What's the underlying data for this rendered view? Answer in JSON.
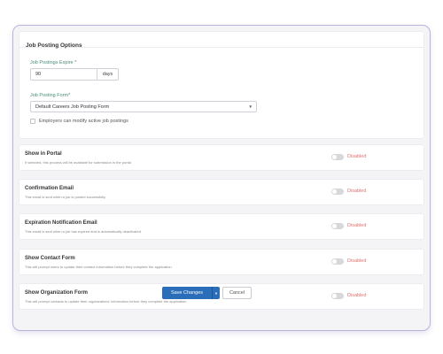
{
  "options": {
    "title": "Job Posting Options",
    "expire_label": "Job Postings Expire *",
    "expire_value": "90",
    "expire_unit": "days",
    "form_label": "Job Posting Form*",
    "form_selected": "Default Careers Job Posting Form",
    "modify_label": "Employers can modify active job postings",
    "modify_checked": false
  },
  "toggles": [
    {
      "title": "Show in Portal",
      "description": "If selected, this process will be available for submission in the portal",
      "status": "Disabled",
      "enabled": false
    },
    {
      "title": "Confirmation Email",
      "description": "This email is sent when a job is posted successfully",
      "status": "Disabled",
      "enabled": false
    },
    {
      "title": "Expiration Notification Email",
      "description": "This email is sent when a job has expired and is automatically deactivated",
      "status": "Disabled",
      "enabled": false
    },
    {
      "title": "Show Contact Form",
      "description": "This will prompt users to update their contact information before they complete the application",
      "status": "Disabled",
      "enabled": false
    },
    {
      "title": "Show Organization Form",
      "description": "This will prompt contacts to update their organizations' information before they complete the application",
      "status": "Disabled",
      "enabled": false
    }
  ],
  "actions": {
    "save_label": "Save Changes",
    "cancel_label": "Cancel"
  },
  "colors": {
    "primary": "#2a6db8",
    "disabled_text": "#e07070",
    "frame_border": "#b9b3dc",
    "label_accent": "#4a8a7a"
  }
}
